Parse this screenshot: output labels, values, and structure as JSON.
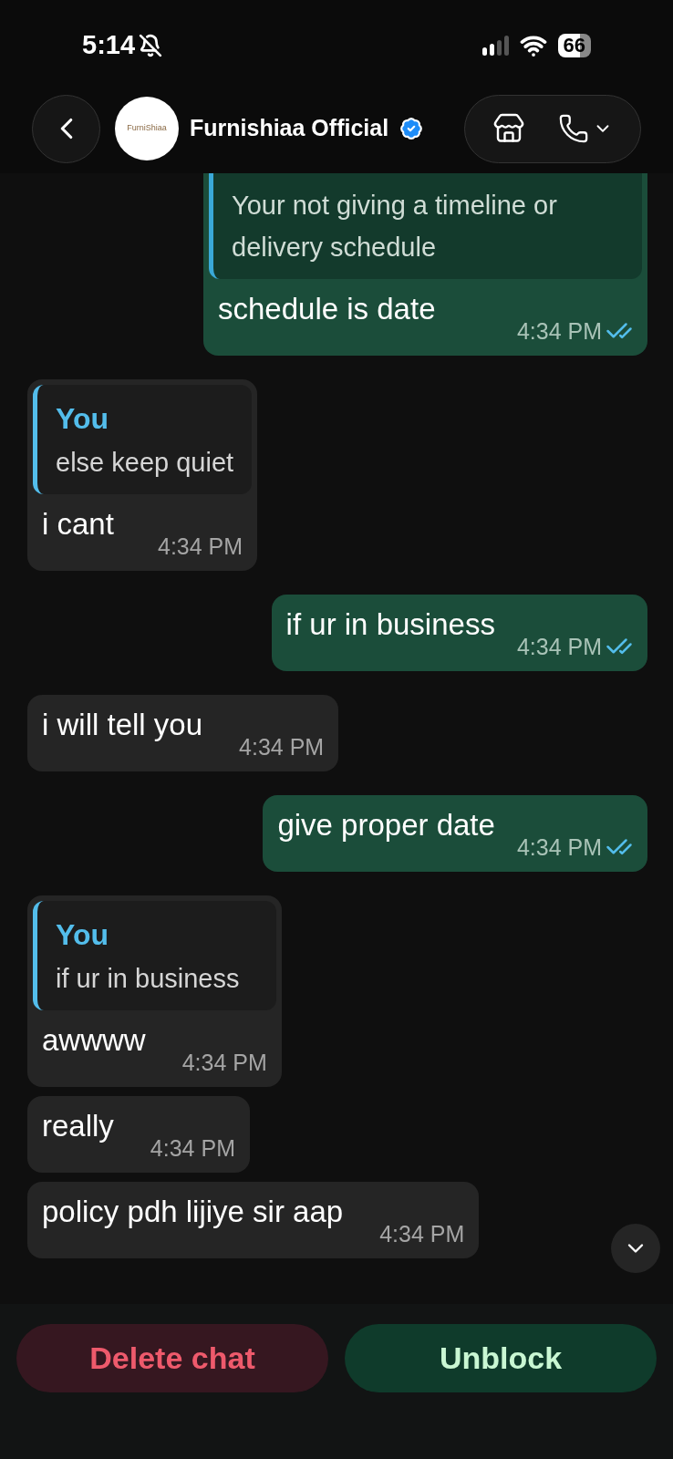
{
  "status_bar": {
    "time": "5:14",
    "battery": "66"
  },
  "header": {
    "avatar_text": "FurniShiaa",
    "name": "Furnishiaa Official",
    "verified": true
  },
  "messages": [
    {
      "kind": "outgoing",
      "quote": {
        "text": "Your not giving a timeline or delivery schedule"
      },
      "text": "schedule is date",
      "time": "4:34 PM",
      "read": true
    },
    {
      "kind": "incoming",
      "quote": {
        "author": "You",
        "text": "else keep quiet"
      },
      "text": "i cant",
      "time": "4:34 PM"
    },
    {
      "kind": "outgoing",
      "text": "if ur in business",
      "time": "4:34 PM",
      "read": true
    },
    {
      "kind": "incoming",
      "text": "i will tell you",
      "time": "4:34 PM"
    },
    {
      "kind": "outgoing",
      "text": "give proper date",
      "time": "4:34 PM",
      "read": true
    },
    {
      "kind": "incoming",
      "quote": {
        "author": "You",
        "text": "if ur in business"
      },
      "text": "awwww",
      "time": "4:34 PM"
    },
    {
      "kind": "incoming",
      "text": "really",
      "time": "4:34 PM"
    },
    {
      "kind": "incoming",
      "text": "policy pdh lijiye sir aap",
      "time": "4:34 PM"
    }
  ],
  "actions": [
    {
      "kind": "danger",
      "label": "Delete chat"
    },
    {
      "kind": "primary",
      "label": "Unblock"
    }
  ]
}
